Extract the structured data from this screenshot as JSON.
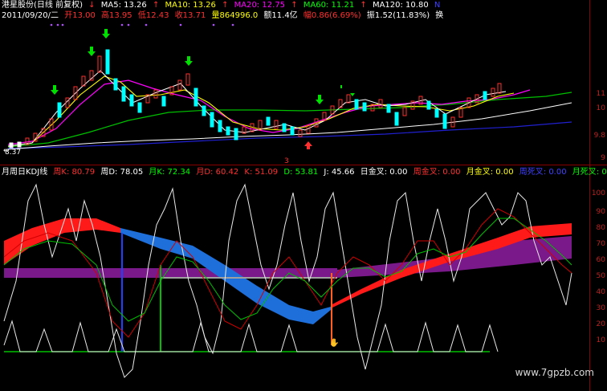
{
  "header": {
    "title": "港星股份(日线 前复权)",
    "ma5": "MA5: 13.26",
    "ma10": "MA10: 13.26",
    "ma20": "MA20: 12.75",
    "ma60": "MA60: 11.21",
    "ma120": "MA120: 10.80",
    "ma_end": "N"
  },
  "quote": {
    "date": "2011/09/20/二",
    "open": "开13.00",
    "high": "高13.95",
    "low": "低12.43",
    "close": "收13.71",
    "volume": "量864996.0",
    "amount": "额11.4亿",
    "change": "幅0.86(6.69%)",
    "amplitude": "振1.52(11.83%)",
    "turnover": "换"
  },
  "price_panel": {
    "low_marker": "8.37",
    "axis_right": [
      "11",
      "10",
      "9.8",
      "9"
    ]
  },
  "kdj_header": {
    "name": "月周日KDJ线",
    "monthK": "周K: 80.79",
    "weekD": "周D: 78.05",
    "monthK2": "月K: 72.34",
    "dayD": "月D: 60.42",
    "k": "K: 51.09",
    "d": "D: 53.81",
    "j": "J: 45.66",
    "dayGold": "日金叉: 0.00",
    "weekGold": "周金叉: 0.00",
    "monthGold": "月金叉: 0.00",
    "weekDead": "周死叉: 0.00",
    "monthDead": "月死叉: 0."
  },
  "kdj_panel": {
    "axis_right": [
      "100",
      "90",
      "80",
      "70",
      "60",
      "50",
      "40",
      "30",
      "20",
      "10"
    ]
  },
  "watermark": "www.7gpzb.com",
  "colors": {
    "up": "#ff3030",
    "down": "#00ffff",
    "ma5": "#ffffff",
    "ma10": "#ffff00",
    "ma20": "#ff00ff",
    "ma60": "#00ff00",
    "ma120": "#ffffff",
    "band_red": "#ff1a1a",
    "band_blue": "#1e6fd9",
    "band_purple": "#7a1a8a"
  }
}
